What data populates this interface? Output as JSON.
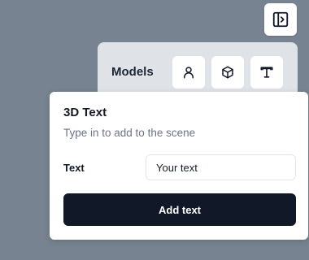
{
  "toolbar": {
    "toggle_icon": "panel-right-toggle-icon"
  },
  "models_panel": {
    "label": "Models",
    "buttons": [
      {
        "icon": "person-icon"
      },
      {
        "icon": "cube-icon"
      },
      {
        "icon": "text-type-icon"
      }
    ]
  },
  "text_card": {
    "title": "3D Text",
    "subtitle": "Type in to add to the scene",
    "field_label": "Text",
    "input_value": "Your text",
    "submit_label": "Add text"
  },
  "colors": {
    "background": "#778390",
    "primary_button": "#111827"
  }
}
